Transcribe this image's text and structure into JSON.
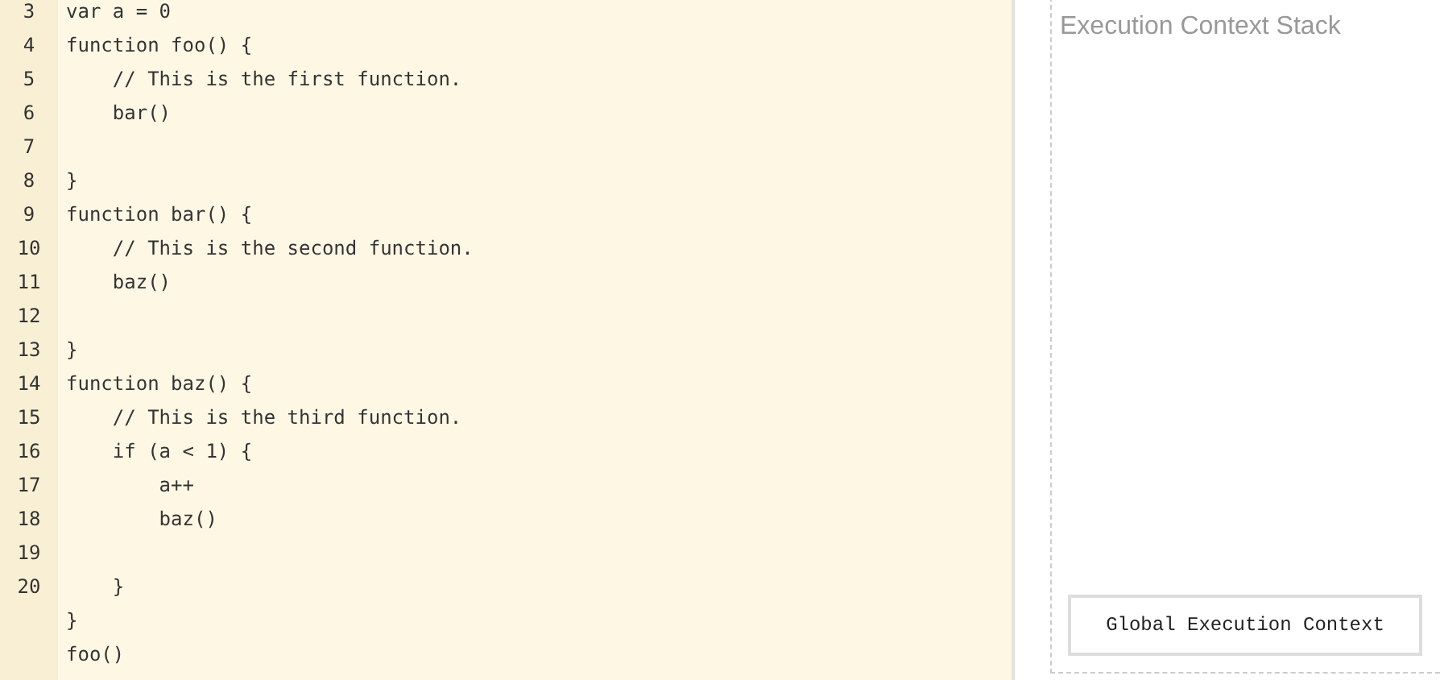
{
  "editor": {
    "lines": [
      {
        "number": "3",
        "text": "var a = 0"
      },
      {
        "number": "4",
        "text": "function foo() {"
      },
      {
        "number": "5",
        "text": "    // This is the first function."
      },
      {
        "number": "6",
        "text": "    bar()"
      },
      {
        "number": "7"
      },
      {
        "number": "8",
        "text": "}"
      },
      {
        "number": "9",
        "text": "function bar() {"
      },
      {
        "number": "10",
        "text": "    // This is the second function."
      },
      {
        "number": "11",
        "text": "    baz()"
      },
      {
        "number": "12"
      },
      {
        "number": "13",
        "text": "}"
      },
      {
        "number": "14",
        "text": "function baz() {"
      },
      {
        "number": "15",
        "text": "    // This is the third function."
      },
      {
        "number": "16",
        "text": "    if (a < 1) {"
      },
      {
        "number": "17",
        "text": "        a++"
      },
      {
        "number": "18",
        "text": "        baz()"
      },
      {
        "number": "19"
      },
      {
        "number": "20",
        "text": "    }"
      },
      {
        "text": "}"
      },
      {
        "text": "foo()"
      }
    ]
  },
  "stack": {
    "title": "Execution Context Stack",
    "frames": [
      "Global Execution Context"
    ]
  }
}
